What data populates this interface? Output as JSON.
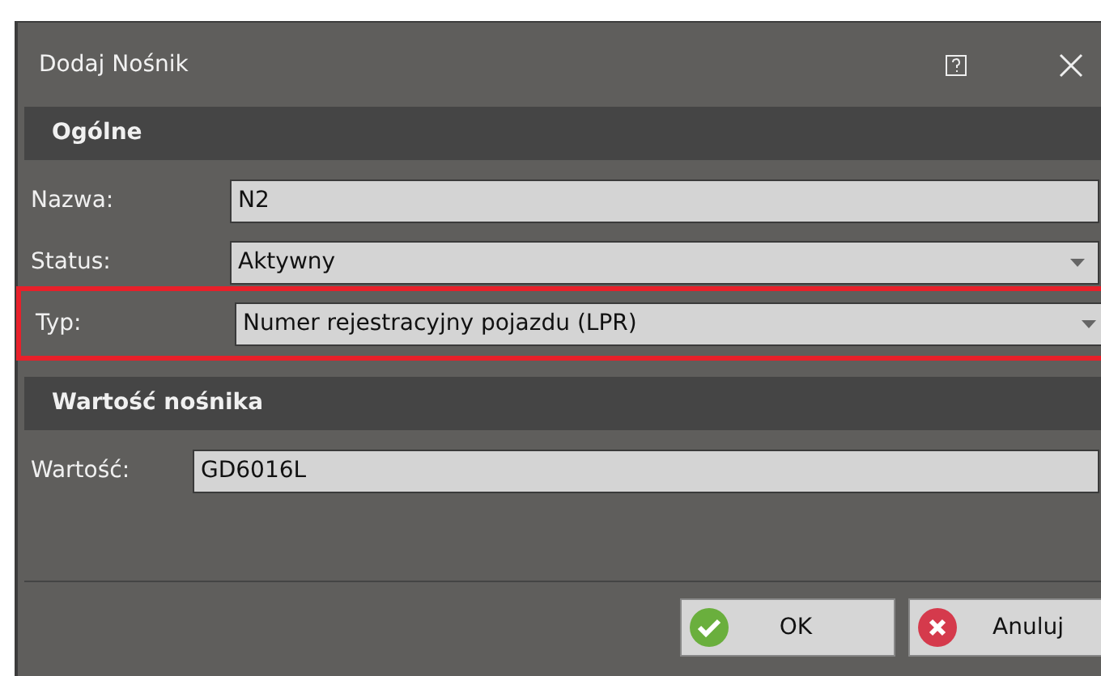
{
  "window": {
    "title": "Dodaj Nośnik"
  },
  "sections": [
    {
      "title": "Ogólne",
      "fields": [
        {
          "label": "Nazwa:",
          "kind": "text",
          "value": "N2",
          "highlighted": false
        },
        {
          "label": "Status:",
          "kind": "dropdown",
          "value": "Aktywny",
          "highlighted": false
        },
        {
          "label": "Typ:",
          "kind": "dropdown",
          "value": "Numer rejestracyjny pojazdu (LPR)",
          "highlighted": true
        }
      ]
    },
    {
      "title": "Wartość nośnika",
      "fields": [
        {
          "label": "Wartość:",
          "kind": "text",
          "value": "GD6016L",
          "highlighted": false
        }
      ]
    }
  ],
  "buttons": [
    {
      "label": "OK",
      "kind": "ok"
    },
    {
      "label": "Anuluj",
      "kind": "cancel"
    }
  ]
}
